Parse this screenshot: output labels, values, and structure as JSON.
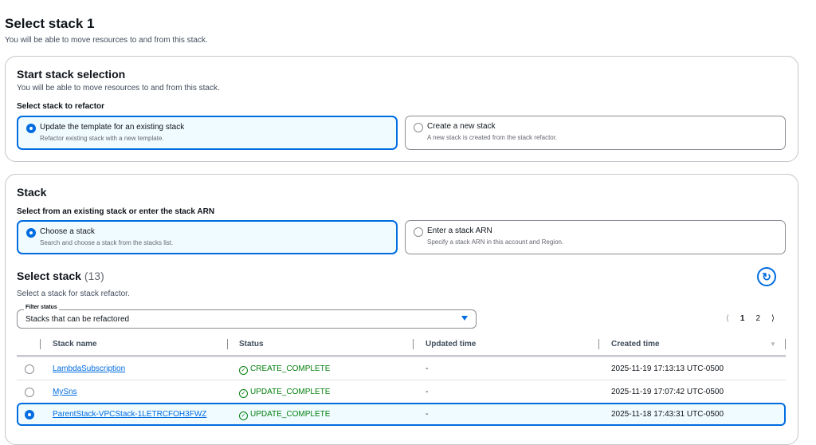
{
  "header": {
    "title": "Select stack 1",
    "description": "You will be able to move resources to and from this stack."
  },
  "start": {
    "title": "Start stack selection",
    "description": "You will be able to move resources to and from this stack.",
    "label": "Select stack to refactor",
    "options": [
      {
        "title": "Update the template for an existing stack",
        "desc": "Refactor existing stack with a new template.",
        "selected": true
      },
      {
        "title": "Create a new stack",
        "desc": "A new stack is created from the stack refactor.",
        "selected": false
      }
    ]
  },
  "stack": {
    "title": "Stack",
    "label": "Select from an existing stack or enter the stack ARN",
    "options": [
      {
        "title": "Choose a stack",
        "desc": "Search and choose a stack from the stacks list.",
        "selected": true
      },
      {
        "title": "Enter a stack ARN",
        "desc": "Specify a stack ARN in this account and Region.",
        "selected": false
      }
    ]
  },
  "select": {
    "title": "Select stack",
    "count": "(13)",
    "description": "Select a stack for stack refactor.",
    "filter_label": "Filter status",
    "filter_value": "Stacks that can be refactored",
    "pages": [
      "1",
      "2"
    ],
    "columns": [
      "Stack name",
      "Status",
      "Updated time",
      "Created time"
    ],
    "rows": [
      {
        "name": "LambdaSubscription",
        "status": "CREATE_COMPLETE",
        "updated": "-",
        "created": "2025-11-19 17:13:13 UTC-0500",
        "selected": false
      },
      {
        "name": "MySns",
        "status": "UPDATE_COMPLETE",
        "updated": "-",
        "created": "2025-11-19 17:07:42 UTC-0500",
        "selected": false
      },
      {
        "name": "ParentStack-VPCStack-1LETRCFOH3FWZ",
        "status": "UPDATE_COMPLETE",
        "updated": "-",
        "created": "2025-11-18 17:43:31 UTC-0500",
        "selected": true
      }
    ]
  },
  "colors": {
    "accent": "#006ce0",
    "success": "#037f0c"
  }
}
